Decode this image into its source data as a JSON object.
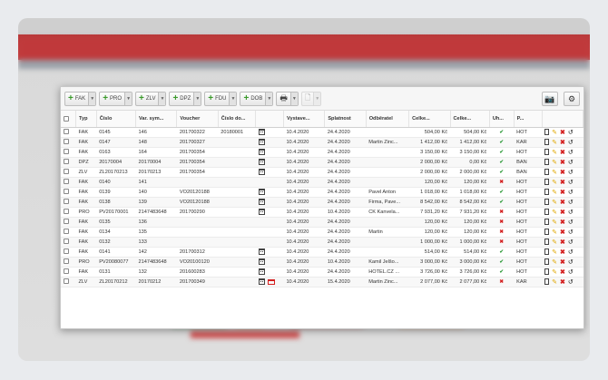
{
  "toolbar": {
    "buttons": [
      {
        "label": "FAK",
        "icon": "plus-icon"
      },
      {
        "label": "PRO",
        "icon": "plus-icon"
      },
      {
        "label": "ZLV",
        "icon": "plus-icon"
      },
      {
        "label": "DPZ",
        "icon": "plus-icon"
      },
      {
        "label": "FDU",
        "icon": "plus-icon"
      },
      {
        "label": "DOB",
        "icon": "plus-icon"
      }
    ],
    "print_icon": "printer-icon",
    "pdf_icon": "document-icon",
    "right_icons": [
      "camera-icon",
      "gear-icon"
    ]
  },
  "table": {
    "headers": [
      "Typ",
      "Číslo",
      "Var. sym...",
      "Voucher",
      "Číslo do...",
      "",
      "Vystave...",
      "Splatnost",
      "Odběratel",
      "Celke...",
      "Celke...",
      "Uh...",
      "P..."
    ],
    "rows": [
      {
        "typ": "FAK",
        "cislo": "0145",
        "vs": "146",
        "voucher": "201700322",
        "cislodo": "20180001",
        "cal": true,
        "card": false,
        "vyst": "10.4.2020",
        "spl": "24.4.2020",
        "odb": "",
        "c1": "504,00 Kč",
        "c2": "504,00 Kč",
        "uh": true,
        "p": "HOT"
      },
      {
        "typ": "FAK",
        "cislo": "0147",
        "vs": "148",
        "voucher": "201700327",
        "cislodo": "",
        "cal": true,
        "card": false,
        "vyst": "10.4.2020",
        "spl": "24.4.2020",
        "odb": "Martin Zinc...",
        "c1": "1 412,00 Kč",
        "c2": "1 412,00 Kč",
        "uh": true,
        "p": "KAR"
      },
      {
        "typ": "FAK",
        "cislo": "0163",
        "vs": "164",
        "voucher": "201700354",
        "cislodo": "",
        "cal": true,
        "card": false,
        "vyst": "10.4.2020",
        "spl": "24.4.2020",
        "odb": "",
        "c1": "3 150,00 Kč",
        "c2": "3 150,00 Kč",
        "uh": true,
        "p": "HOT"
      },
      {
        "typ": "DPZ",
        "cislo": "20170004",
        "vs": "20170004",
        "voucher": "201700354",
        "cislodo": "",
        "cal": true,
        "card": false,
        "vyst": "10.4.2020",
        "spl": "24.4.2020",
        "odb": "",
        "c1": "2 000,00 Kč",
        "c2": "0,00 Kč",
        "uh": true,
        "p": "BAN"
      },
      {
        "typ": "ZLV",
        "cislo": "ZL20170213",
        "vs": "20170213",
        "voucher": "201700354",
        "cislodo": "",
        "cal": true,
        "card": false,
        "vyst": "10.4.2020",
        "spl": "24.4.2020",
        "odb": "",
        "c1": "2 000,00 Kč",
        "c2": "2 000,00 Kč",
        "uh": true,
        "p": "BAN"
      },
      {
        "typ": "FAK",
        "cislo": "0140",
        "vs": "141",
        "voucher": "",
        "cislodo": "",
        "cal": false,
        "card": false,
        "vyst": "10.4.2020",
        "spl": "24.4.2020",
        "odb": "",
        "c1": "120,00 Kč",
        "c2": "120,00 Kč",
        "uh": false,
        "p": "HOT"
      },
      {
        "typ": "FAK",
        "cislo": "0139",
        "vs": "140",
        "voucher": "VO20120188",
        "cislodo": "",
        "cal": true,
        "card": false,
        "vyst": "10.4.2020",
        "spl": "24.4.2020",
        "odb": "Pavel Anton",
        "c1": "1 018,00 Kč",
        "c2": "1 018,00 Kč",
        "uh": true,
        "p": "HOT"
      },
      {
        "typ": "FAK",
        "cislo": "0138",
        "vs": "139",
        "voucher": "VO20120188",
        "cislodo": "",
        "cal": true,
        "card": false,
        "vyst": "10.4.2020",
        "spl": "24.4.2020",
        "odb": "Firma, Pave...",
        "c1": "8 542,00 Kč",
        "c2": "8 542,00 Kč",
        "uh": true,
        "p": "HOT"
      },
      {
        "typ": "PRO",
        "cislo": "PV20170001",
        "vs": "2147483648",
        "voucher": "201700290",
        "cislodo": "",
        "cal": true,
        "card": false,
        "vyst": "10.4.2020",
        "spl": "10.4.2020",
        "odb": "CK Kanvela...",
        "c1": "7 931,20 Kč",
        "c2": "7 931,20 Kč",
        "uh": false,
        "p": "HOT"
      },
      {
        "typ": "FAK",
        "cislo": "0135",
        "vs": "136",
        "voucher": "",
        "cislodo": "",
        "cal": false,
        "card": false,
        "vyst": "10.4.2020",
        "spl": "24.4.2020",
        "odb": "",
        "c1": "120,00 Kč",
        "c2": "120,00 Kč",
        "uh": false,
        "p": "HOT"
      },
      {
        "typ": "FAK",
        "cislo": "0134",
        "vs": "135",
        "voucher": "",
        "cislodo": "",
        "cal": false,
        "card": false,
        "vyst": "10.4.2020",
        "spl": "24.4.2020",
        "odb": "Martin",
        "c1": "120,00 Kč",
        "c2": "120,00 Kč",
        "uh": false,
        "p": "HOT"
      },
      {
        "typ": "FAK",
        "cislo": "0132",
        "vs": "133",
        "voucher": "",
        "cislodo": "",
        "cal": false,
        "card": false,
        "vyst": "10.4.2020",
        "spl": "24.4.2020",
        "odb": "",
        "c1": "1 000,00 Kč",
        "c2": "1 000,00 Kč",
        "uh": false,
        "p": "HOT"
      },
      {
        "typ": "FAK",
        "cislo": "0141",
        "vs": "142",
        "voucher": "201700312",
        "cislodo": "",
        "cal": true,
        "card": false,
        "vyst": "10.4.2020",
        "spl": "24.4.2020",
        "odb": "",
        "c1": "514,00 Kč",
        "c2": "514,00 Kč",
        "uh": true,
        "p": "HOT"
      },
      {
        "typ": "PRO",
        "cislo": "PV20080077",
        "vs": "2147483648",
        "voucher": "VO20100120",
        "cislodo": "",
        "cal": true,
        "card": false,
        "vyst": "10.4.2020",
        "spl": "10.4.2020",
        "odb": "Kamil Jelšo...",
        "c1": "3 000,00 Kč",
        "c2": "3 000,00 Kč",
        "uh": true,
        "p": "HOT"
      },
      {
        "typ": "FAK",
        "cislo": "0131",
        "vs": "132",
        "voucher": "201600283",
        "cislodo": "",
        "cal": true,
        "card": false,
        "vyst": "10.4.2020",
        "spl": "24.4.2020",
        "odb": "HOTEL.CZ ...",
        "c1": "3 726,00 Kč",
        "c2": "3 726,00 Kč",
        "uh": true,
        "p": "HOT"
      },
      {
        "typ": "ZLV",
        "cislo": "ZL20170212",
        "vs": "20170212",
        "voucher": "201700349",
        "cislodo": "",
        "cal": true,
        "card": true,
        "vyst": "10.4.2020",
        "spl": "15.4.2020",
        "odb": "Martin Zinc...",
        "c1": "2 077,00 Kč",
        "c2": "2 077,00 Kč",
        "uh": false,
        "p": "KAR"
      }
    ],
    "check_mark": "✔",
    "cross_mark": "✖"
  },
  "colors": {
    "accent_red": "#c0393b",
    "ok_green": "#2e9a3a",
    "error_red": "#d42020"
  }
}
